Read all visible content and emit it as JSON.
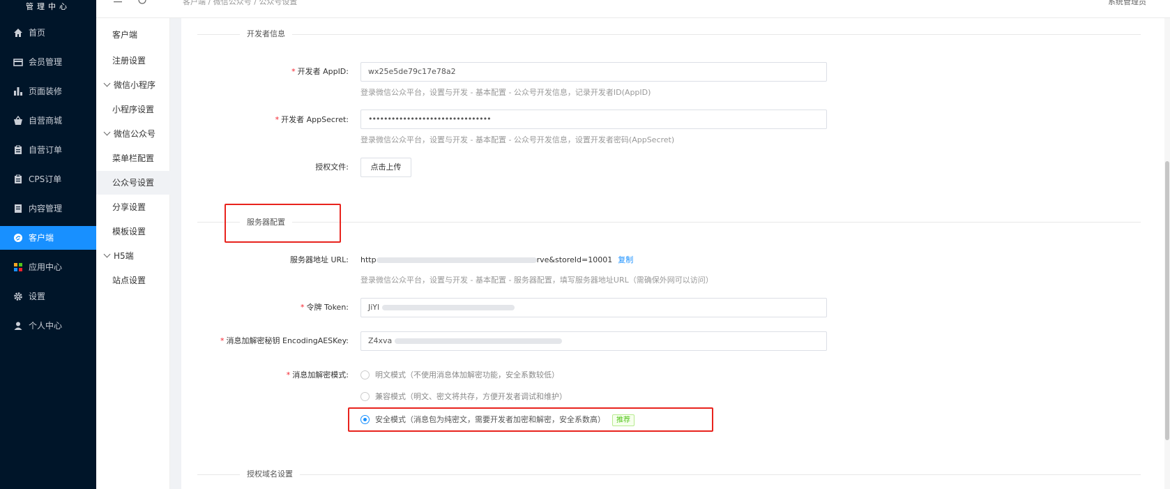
{
  "sidebar": {
    "title": "管理中心",
    "items": [
      {
        "label": "首页",
        "icon": "home-icon"
      },
      {
        "label": "会员管理",
        "icon": "card-icon"
      },
      {
        "label": "页面装修",
        "icon": "bar-chart-icon"
      },
      {
        "label": "自营商城",
        "icon": "basket-icon"
      },
      {
        "label": "自营订单",
        "icon": "clipboard-icon"
      },
      {
        "label": "CPS订单",
        "icon": "clipboard-icon"
      },
      {
        "label": "内容管理",
        "icon": "document-icon"
      },
      {
        "label": "客户端",
        "icon": "client-icon",
        "active": true
      },
      {
        "label": "应用中心",
        "icon": "apps-icon"
      },
      {
        "label": "设置",
        "icon": "gear-icon"
      },
      {
        "label": "个人中心",
        "icon": "user-icon"
      }
    ]
  },
  "submenu": {
    "items": [
      {
        "label": "客户端"
      },
      {
        "label": "注册设置"
      },
      {
        "label": "微信小程序",
        "group": true
      },
      {
        "label": "小程序设置"
      },
      {
        "label": "微信公众号",
        "group": true
      },
      {
        "label": "菜单栏配置"
      },
      {
        "label": "公众号设置",
        "active": true
      },
      {
        "label": "分享设置"
      },
      {
        "label": "模板设置"
      },
      {
        "label": "H5端",
        "group": true
      },
      {
        "label": "站点设置"
      }
    ]
  },
  "header": {
    "breadcrumb": "客户端 / 微信公众号 / 公众号设置",
    "user": "系统管理员"
  },
  "developer": {
    "section_title": "开发者信息",
    "appid_label": "开发者 AppID:",
    "appid_value": "wx25e5de79c17e78a2",
    "appid_hint": "登录微信公众平台，设置与开发 - 基本配置 - 公众号开发信息，记录开发者ID(AppID)",
    "secret_label": "开发者 AppSecret:",
    "secret_value": "••••••••••••••••••••••••••••••••",
    "secret_hint": "登录微信公众平台，设置与开发 - 基本配置 - 公众号开发信息，设置开发者密码(AppSecret)",
    "auth_file_label": "授权文件:",
    "upload_label": "点击上传"
  },
  "server": {
    "section_title": "服务器配置",
    "url_label": "服务器地址 URL:",
    "url_prefix": "http",
    "url_suffix": "rve&storeId=10001",
    "copy_label": "复制",
    "url_hint": "登录微信公众平台，设置与开发 - 基本配置 - 服务器配置，填写服务器地址URL（需确保外网可以访问）",
    "token_label": "令牌 Token:",
    "token_value": "JiYl",
    "aes_label": "消息加解密秘钥 EncodingAESKey:",
    "aes_value": "Z4xva",
    "mode_label": "消息加解密模式:",
    "modes": [
      {
        "label": "明文模式（不使用消息体加解密功能，安全系数较低）",
        "checked": false
      },
      {
        "label": "兼容模式（明文、密文将共存，方便开发者调试和维护）",
        "checked": false
      },
      {
        "label": "安全模式（消息包为纯密文，需要开发者加密和解密，安全系数高）",
        "checked": true
      }
    ],
    "recommend_tag": "推荐"
  },
  "domain": {
    "section_title": "授权域名设置"
  },
  "colors": {
    "sidebar_bg": "#001529",
    "accent": "#1890ff",
    "highlight_box": "#e8231d",
    "required": "#f5222d"
  }
}
